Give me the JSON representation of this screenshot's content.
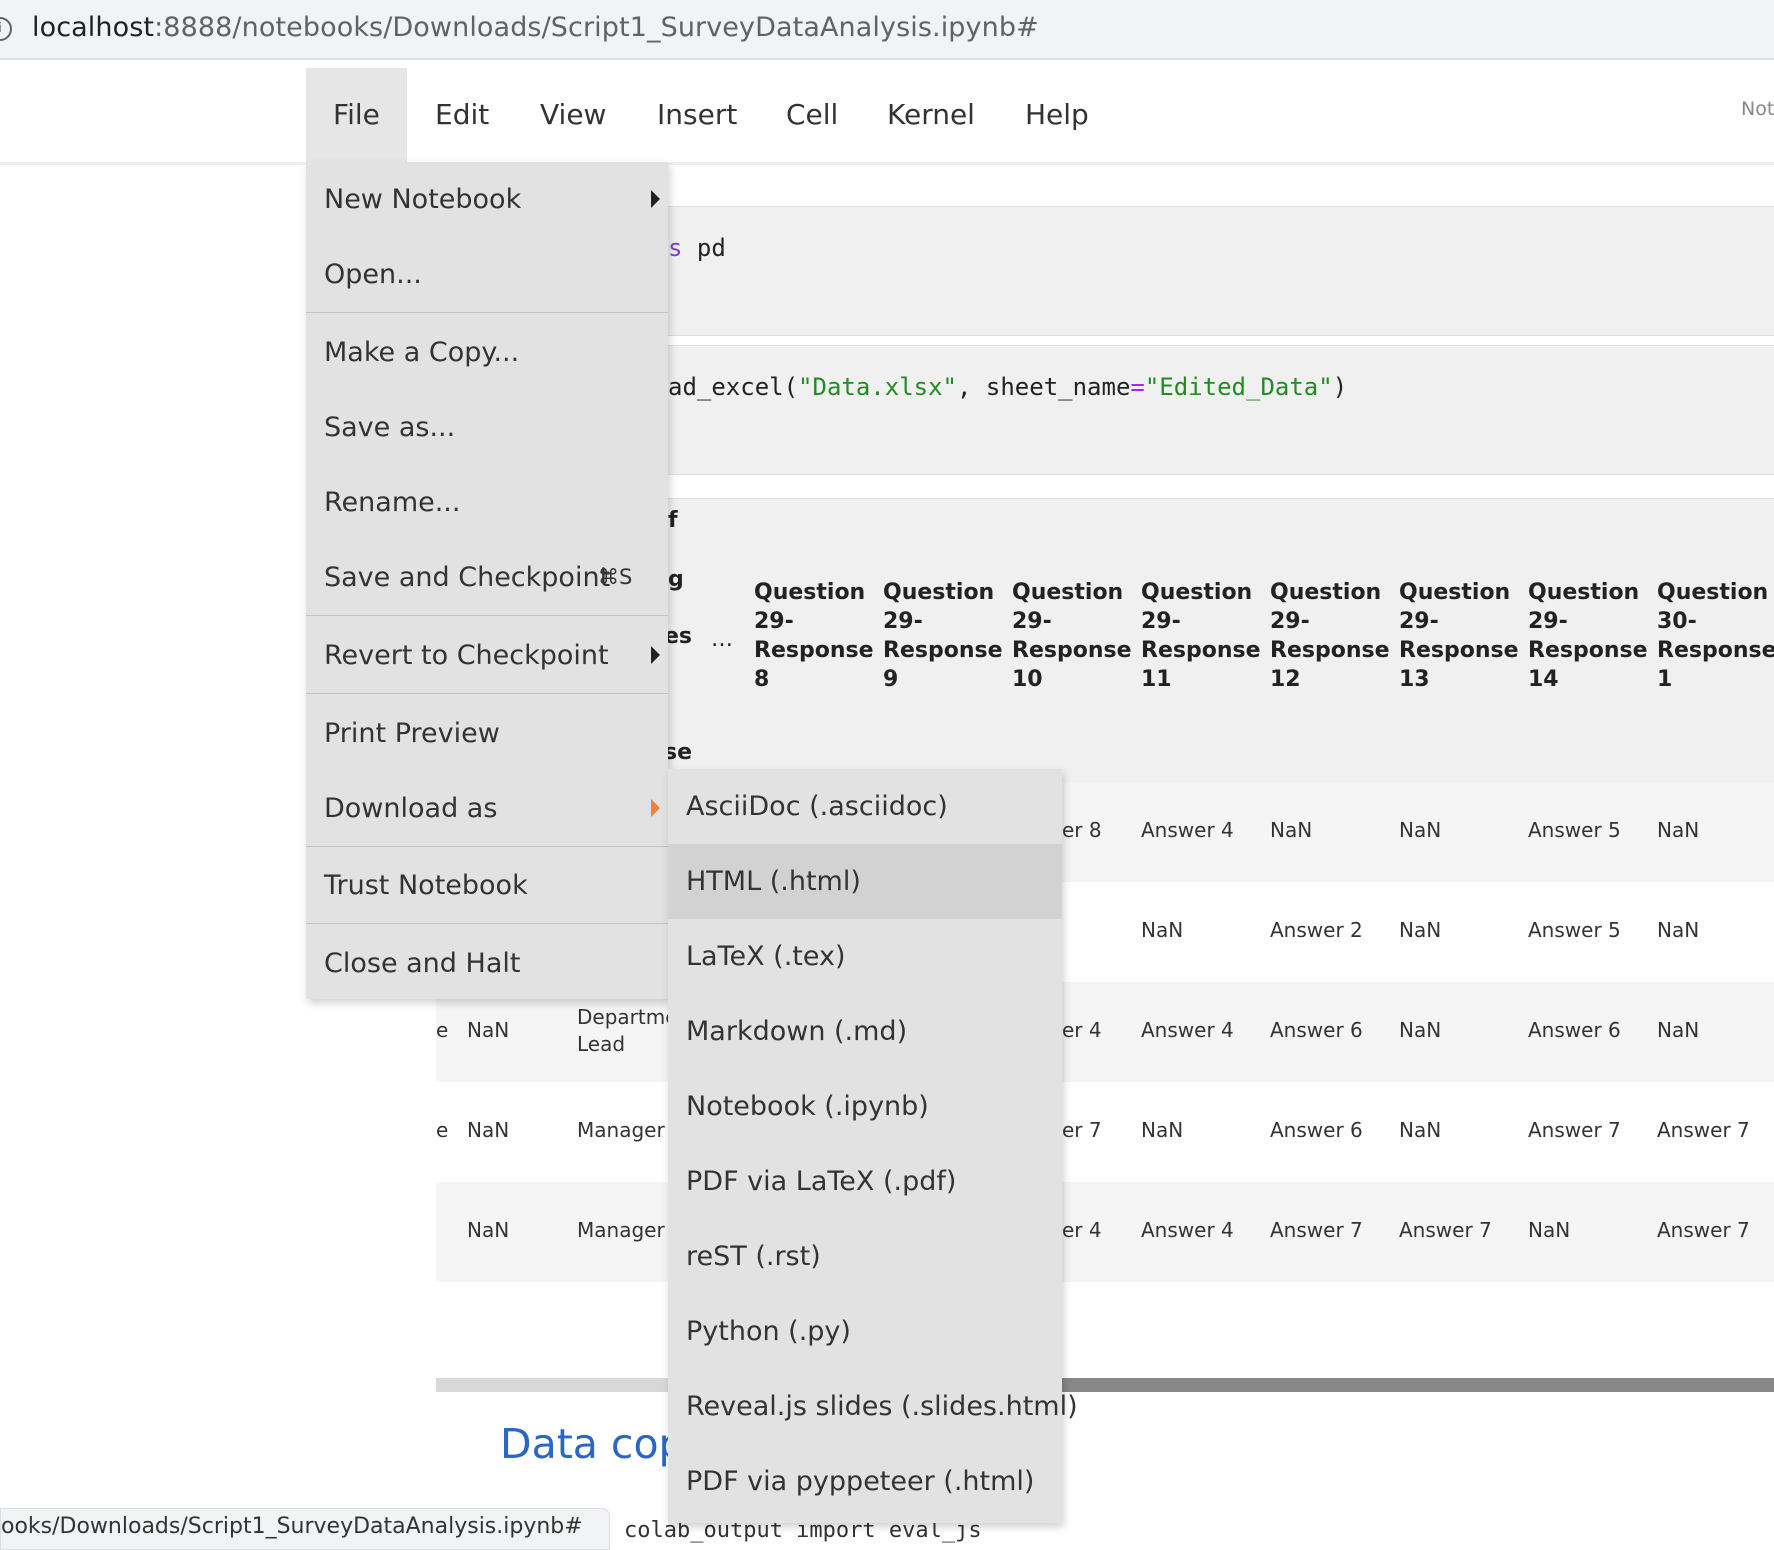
{
  "browser": {
    "url_host": "localhost",
    "url_path": ":8888/notebooks/Downloads/Script1_SurveyDataAnalysis.ipynb#"
  },
  "menubar": {
    "items": [
      "File",
      "Edit",
      "View",
      "Insert",
      "Cell",
      "Kernel",
      "Help"
    ],
    "active": "File",
    "notice_fragment": "Not"
  },
  "cells": {
    "cell1_code_kw": "s",
    "cell1_code_rest": " pd",
    "cell2_code_a": "ad_excel(",
    "cell2_str1": "\"Data.xlsx\"",
    "cell2_code_b": ", sheet_name",
    "cell2_op": "=",
    "cell2_str2": "\"Edited_Data\"",
    "cell2_code_c": ")"
  },
  "table": {
    "fragments": [
      "f",
      "g",
      "es",
      "…",
      "se"
    ],
    "headers": [
      "Question 29-Response 8",
      "Question 29-Response 9",
      "Question 29-Response 10",
      "Question 29-Response 11",
      "Question 29-Response 12",
      "Question 29-Response 13",
      "Question 29-Response 14",
      "Question 30-Response 1"
    ],
    "header_lines": [
      [
        "Question",
        "29-",
        "Response",
        "8"
      ],
      [
        "Question",
        "29-",
        "Response",
        "9"
      ],
      [
        "Question",
        "29-",
        "Response",
        "10"
      ],
      [
        "Question",
        "29-",
        "Response",
        "11"
      ],
      [
        "Question",
        "29-",
        "Response",
        "12"
      ],
      [
        "Question",
        "29-",
        "Response",
        "13"
      ],
      [
        "Question",
        "29-",
        "Response",
        "14"
      ],
      [
        "Question",
        "30-",
        "Response",
        "1"
      ]
    ],
    "rows": [
      {
        "left": [
          "",
          "",
          ""
        ],
        "mid": "er 8",
        "cells": [
          "Answer 4",
          "NaN",
          "NaN",
          "Answer 5",
          "NaN"
        ]
      },
      {
        "left": [
          "",
          "",
          ""
        ],
        "mid": "",
        "cells": [
          "NaN",
          "Answer 2",
          "NaN",
          "Answer 5",
          "NaN"
        ]
      },
      {
        "left": [
          "e",
          "NaN",
          "Departme\nLead"
        ],
        "mid": "er 4",
        "cells": [
          "Answer 4",
          "Answer 6",
          "NaN",
          "Answer 6",
          "NaN"
        ]
      },
      {
        "left": [
          "e",
          "NaN",
          "Manager"
        ],
        "mid": "er 7",
        "cells": [
          "NaN",
          "Answer 6",
          "NaN",
          "Answer 7",
          "Answer 7"
        ]
      },
      {
        "left": [
          "",
          "NaN",
          "Manager"
        ],
        "mid": "er 4",
        "cells": [
          "Answer 4",
          "Answer 7",
          "Answer 7",
          "NaN",
          "Answer 7"
        ]
      }
    ]
  },
  "markdown_heading": "Data copy",
  "status_bar": "ooks/Downloads/Script1_SurveyDataAnalysis.ipynb#",
  "bottom_code_fragment": "colab_output import eval_js",
  "file_menu": {
    "items": [
      {
        "label": "New Notebook",
        "submenu": true
      },
      {
        "label": "Open...",
        "submenu": false
      },
      {
        "label": "Make a Copy...",
        "submenu": false
      },
      {
        "label": "Save as...",
        "submenu": false
      },
      {
        "label": "Rename...",
        "submenu": false
      },
      {
        "label": "Save and Checkpoint",
        "shortcut": "⌘S"
      },
      {
        "label": "Revert to Checkpoint",
        "submenu": true
      },
      {
        "label": "Print Preview",
        "submenu": false
      },
      {
        "label": "Download as",
        "submenu": true,
        "open": true
      },
      {
        "label": "Trust Notebook",
        "submenu": false
      },
      {
        "label": "Close and Halt",
        "submenu": false
      }
    ]
  },
  "download_submenu": {
    "items": [
      "AsciiDoc (.asciidoc)",
      "HTML (.html)",
      "LaTeX (.tex)",
      "Markdown (.md)",
      "Notebook (.ipynb)",
      "PDF via LaTeX (.pdf)",
      "reST (.rst)",
      "Python (.py)",
      "Reveal.js slides (.slides.html)",
      "PDF via pyppeteer (.html)"
    ],
    "highlighted": "HTML (.html)"
  },
  "colors": {
    "link_blue": "#2a66c8",
    "caret_orange": "#f0823c",
    "menu_bg": "#e2e2e2"
  }
}
